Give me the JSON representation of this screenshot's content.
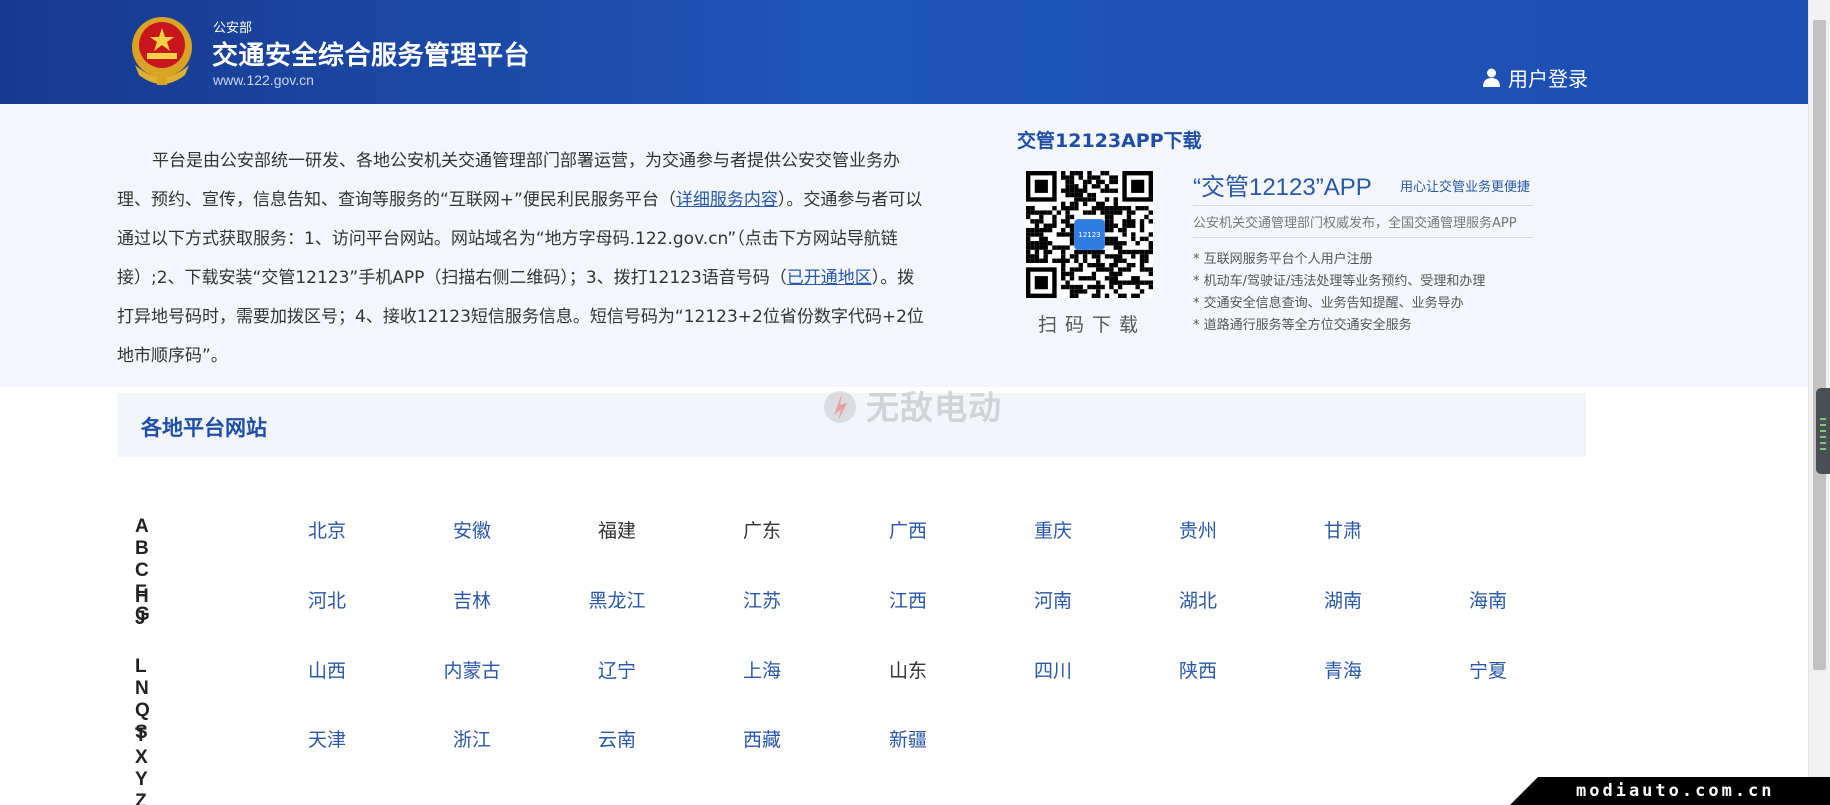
{
  "header": {
    "org": "公安部",
    "title": "交通安全综合服务管理平台",
    "url": "www.122.gov.cn",
    "login_label": "用户登录"
  },
  "intro": {
    "part1": "平台是由公安部统一研发、各地公安机关交通管理部门部署运营，为交通参与者提供公安交管业务办理、预约、宣传，信息告知、查询等服务的“互联网+”便民利民服务平台（",
    "link1": "详细服务内容",
    "part2": "）。交通参与者可以通过以下方式获取服务：1、访问平台网站。网站域名为“地方字母码.122.gov.cn”（点击下方网站导航链接）;2、下载安装“交管12123”手机APP（扫描右侧二维码）；3、拨打12123语音号码（",
    "link2": "已开通地区",
    "part3": "）。拨打异地号码时，需要加拨区号；4、接收12123短信服务信息。短信号码为“12123+2位省份数字代码+2位地市顺序码”。"
  },
  "app": {
    "section_title": "交管12123APP下载",
    "qr_caption": "扫码下载",
    "qr_badge": "12123",
    "name": "“交管12123”APP",
    "slogan": "用心让交管业务更便捷",
    "subtitle": "公安机关交通管理部门权威发布，全国交通管理服务APP",
    "features": [
      "互联网服务平台个人用户注册",
      "机动车/驾驶证/违法处理等业务预约、受理和办理",
      "交通安全信息查询、业务告知提醒、业务导办",
      "道路通行服务等全方位交通安全服务"
    ]
  },
  "regions": {
    "title": "各地平台网站",
    "rows": [
      {
        "label": "A B C F G",
        "items": [
          {
            "name": "北京",
            "linked": true
          },
          {
            "name": "安徽",
            "linked": true
          },
          {
            "name": "福建",
            "linked": false
          },
          {
            "name": "广东",
            "linked": false
          },
          {
            "name": "广西",
            "linked": true
          },
          {
            "name": "重庆",
            "linked": true
          },
          {
            "name": "贵州",
            "linked": true
          },
          {
            "name": "甘肃",
            "linked": true
          }
        ]
      },
      {
        "label": "H J",
        "items": [
          {
            "name": "河北",
            "linked": true
          },
          {
            "name": "吉林",
            "linked": true
          },
          {
            "name": "黑龙江",
            "linked": true
          },
          {
            "name": "江苏",
            "linked": true
          },
          {
            "name": "江西",
            "linked": true
          },
          {
            "name": "河南",
            "linked": true
          },
          {
            "name": "湖北",
            "linked": true
          },
          {
            "name": "湖南",
            "linked": true
          },
          {
            "name": "海南",
            "linked": true
          }
        ]
      },
      {
        "label": "L N Q S",
        "items": [
          {
            "name": "山西",
            "linked": true
          },
          {
            "name": "内蒙古",
            "linked": true
          },
          {
            "name": "辽宁",
            "linked": true
          },
          {
            "name": "上海",
            "linked": true
          },
          {
            "name": "山东",
            "linked": false
          },
          {
            "name": "四川",
            "linked": true
          },
          {
            "name": "陕西",
            "linked": true
          },
          {
            "name": "青海",
            "linked": true
          },
          {
            "name": "宁夏",
            "linked": true
          }
        ]
      },
      {
        "label": "T X Y Z",
        "items": [
          {
            "name": "天津",
            "linked": true
          },
          {
            "name": "浙江",
            "linked": true
          },
          {
            "name": "云南",
            "linked": true
          },
          {
            "name": "西藏",
            "linked": true
          },
          {
            "name": "新疆",
            "linked": true
          }
        ]
      }
    ]
  },
  "watermark": {
    "text": "无敌电动"
  },
  "footer_strip": {
    "text": "modiauto.com.cn"
  },
  "colors": {
    "header_start": "#173a8e",
    "header_end": "#1d4fb3",
    "link": "#2a58a8",
    "intro_bg": "#f3f6fa",
    "section_title": "#1f4ea6"
  }
}
